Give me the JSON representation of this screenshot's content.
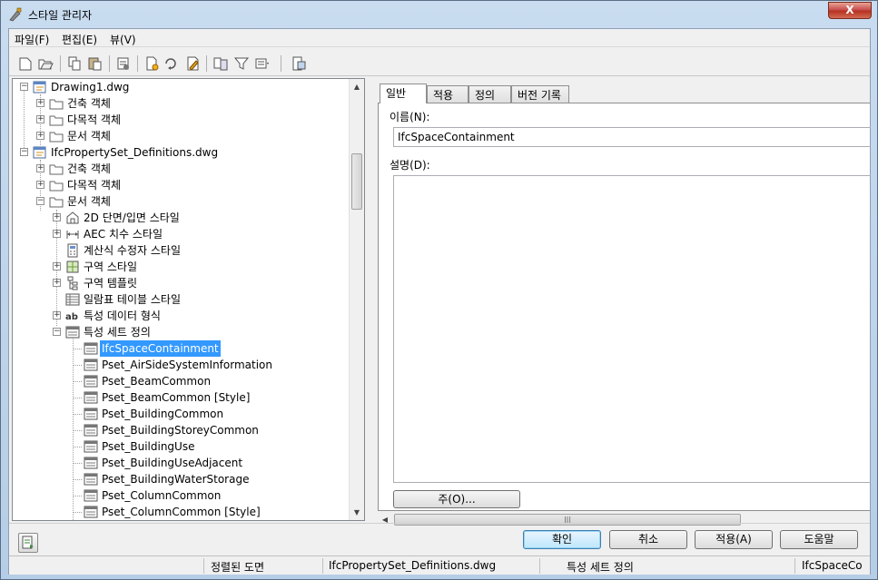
{
  "window": {
    "title": "스타일 관리자",
    "close_glyph": "X"
  },
  "menu": [
    "파일(F)",
    "편집(E)",
    "뷰(V)"
  ],
  "toolbar": {
    "icons": [
      "new-drawing-icon",
      "open-drawing-icon",
      "copy-icon",
      "paste-icon",
      "purge-icon",
      "new-style-icon",
      "set-from-icon",
      "edit-style-icon",
      "toggle-view-icon",
      "filter-icon",
      "view-options-icon",
      "inline-edit-icon"
    ]
  },
  "tree": {
    "drawing1": "Drawing1.dwg",
    "d1_arch": "건축 객체",
    "d1_multi": "다목적 객체",
    "d1_doc": "문서 객체",
    "ifc": "IfcPropertySet_Definitions.dwg",
    "ifc_arch": "건축 객체",
    "ifc_multi": "다목적 객체",
    "ifc_doc": "문서 객체",
    "doc_children": [
      "2D 단면/입면 스타일",
      "AEC 치수 스타일",
      "계산식 수정자 스타일",
      "구역 스타일",
      "구역 템플릿",
      "일람표 테이블 스타일",
      "특성 데이터 형식",
      "특성 세트 정의"
    ],
    "pset_items": [
      "IfcSpaceContainment",
      "Pset_AirSideSystemInformation",
      "Pset_BeamCommon",
      "Pset_BeamCommon [Style]",
      "Pset_BuildingCommon",
      "Pset_BuildingStoreyCommon",
      "Pset_BuildingUse",
      "Pset_BuildingUseAdjacent",
      "Pset_BuildingWaterStorage",
      "Pset_ColumnCommon",
      "Pset_ColumnCommon [Style]"
    ],
    "selected": "IfcSpaceContainment"
  },
  "tabs": [
    "일반",
    "적용",
    "정의",
    "버전 기록"
  ],
  "general": {
    "name_label": "이름(N):",
    "name_value": "IfcSpaceContainment",
    "desc_label": "설명(D):",
    "desc_value": "",
    "note_button": "주(O)..."
  },
  "buttons": {
    "ok": "확인",
    "cancel": "취소",
    "apply": "적용(A)",
    "help": "도움말"
  },
  "status": {
    "cell1": "정렬된 도면",
    "cell2": "IfcPropertySet_Definitions.dwg",
    "cell3": "특성 세트 정의",
    "cell4": "IfcSpaceCo"
  }
}
